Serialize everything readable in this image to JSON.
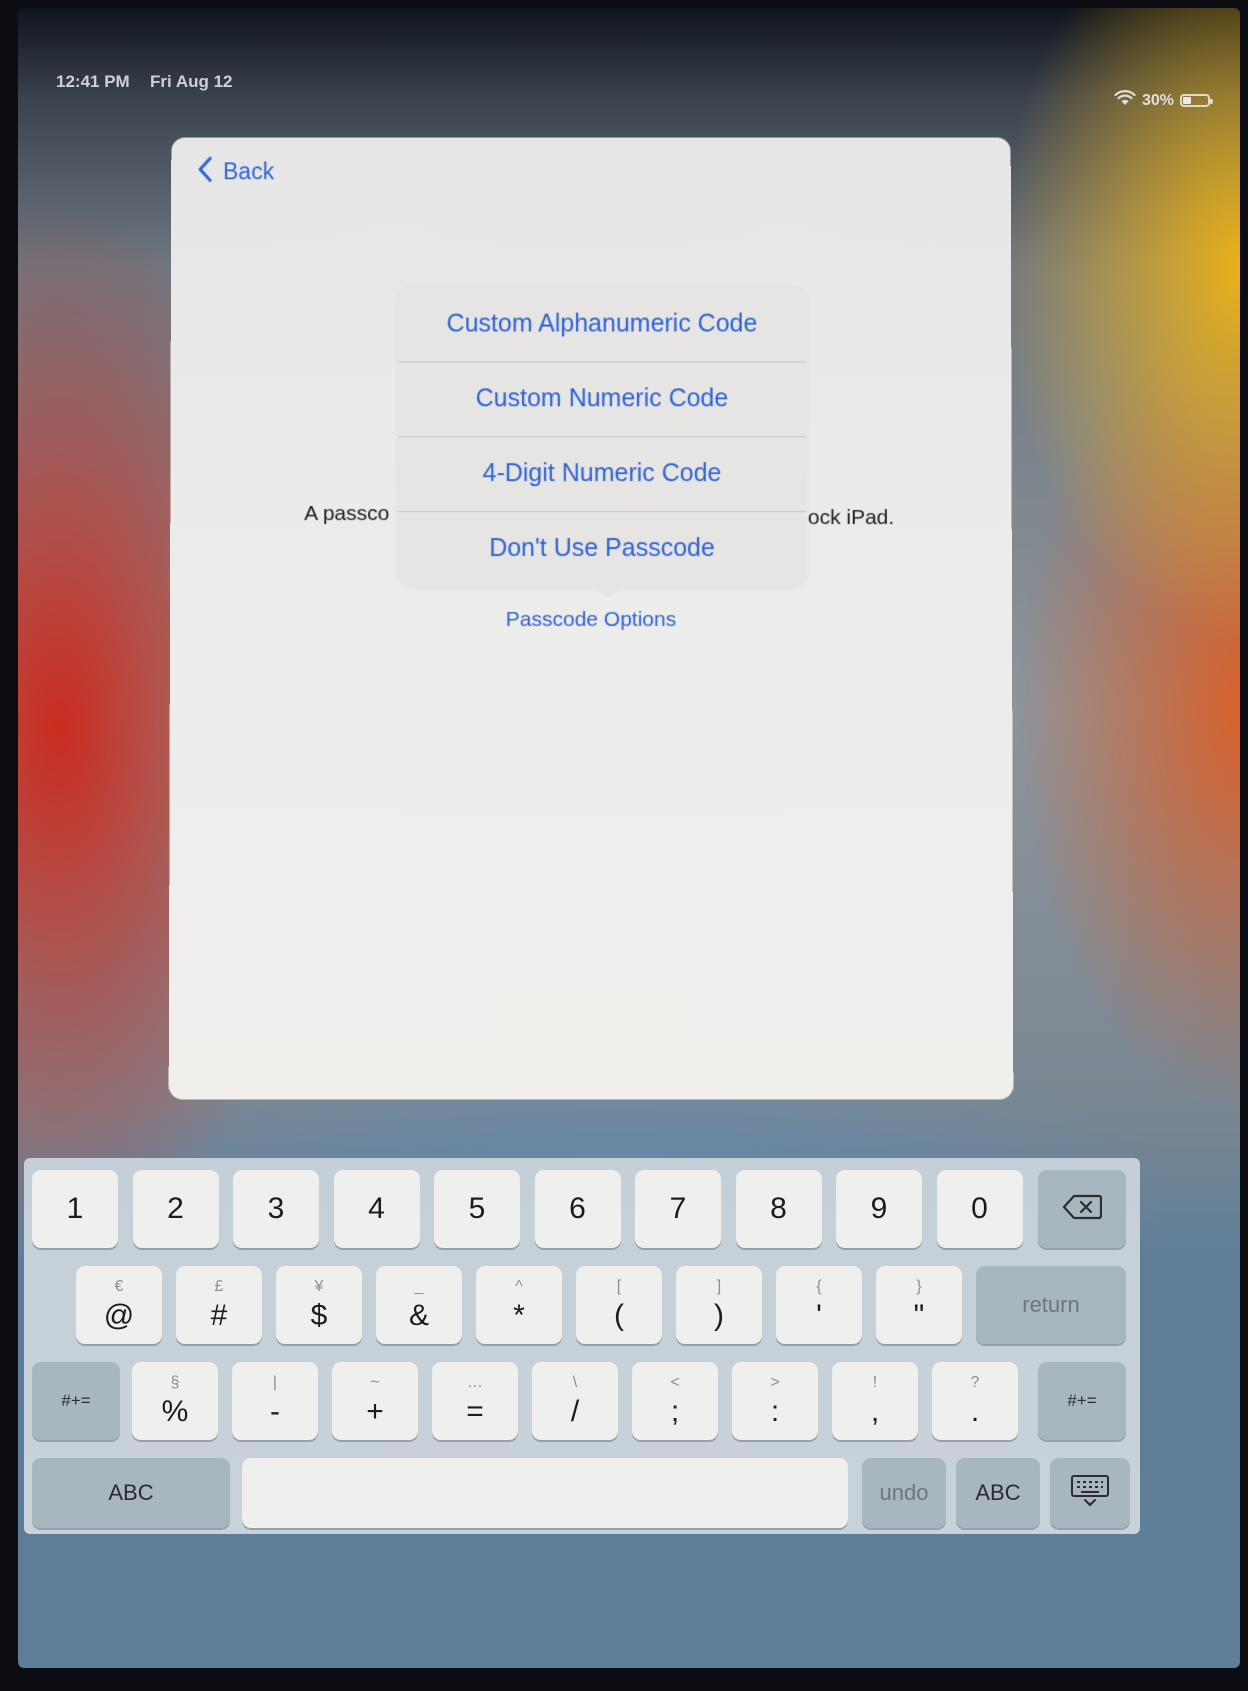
{
  "status_bar": {
    "time": "12:41 PM",
    "date": "Fri Aug 12",
    "battery_text": "30%",
    "battery_level": 0.3,
    "wifi_icon": "wifi-icon",
    "battery_icon": "battery-icon"
  },
  "sheet": {
    "back_label": "Back",
    "description_left": "A passco",
    "description_right": "ock iPad.",
    "passcode_options_label": "Passcode Options"
  },
  "popover": {
    "items": [
      "Custom Alphanumeric Code",
      "Custom Numeric Code",
      "4-Digit Numeric Code",
      "Don't Use Passcode"
    ]
  },
  "keyboard": {
    "row1": [
      "1",
      "2",
      "3",
      "4",
      "5",
      "6",
      "7",
      "8",
      "9",
      "0"
    ],
    "row2": [
      {
        "main": "@",
        "alt": "€"
      },
      {
        "main": "#",
        "alt": "£"
      },
      {
        "main": "$",
        "alt": "¥"
      },
      {
        "main": "&",
        "alt": "_"
      },
      {
        "main": "*",
        "alt": "^"
      },
      {
        "main": "(",
        "alt": "["
      },
      {
        "main": ")",
        "alt": "]"
      },
      {
        "main": "'",
        "alt": "{"
      },
      {
        "main": "\"",
        "alt": "}"
      }
    ],
    "row3": [
      {
        "main": "%",
        "alt": "§"
      },
      {
        "main": "-",
        "alt": "|"
      },
      {
        "main": "+",
        "alt": "~"
      },
      {
        "main": "=",
        "alt": "…"
      },
      {
        "main": "/",
        "alt": "\\"
      },
      {
        "main": ";",
        "alt": "<"
      },
      {
        "main": ":",
        "alt": ">"
      },
      {
        "main": ",",
        "alt": "!"
      },
      {
        "main": ".",
        "alt": "?"
      }
    ],
    "return_label": "return",
    "shift_label_left": "#+=",
    "shift_label_right": "#+=",
    "abc_left_label": "ABC",
    "undo_label": "undo",
    "abc_right_label": "ABC",
    "delete_icon": "delete-icon",
    "hide_keyboard_icon": "keyboard-hide-icon"
  }
}
